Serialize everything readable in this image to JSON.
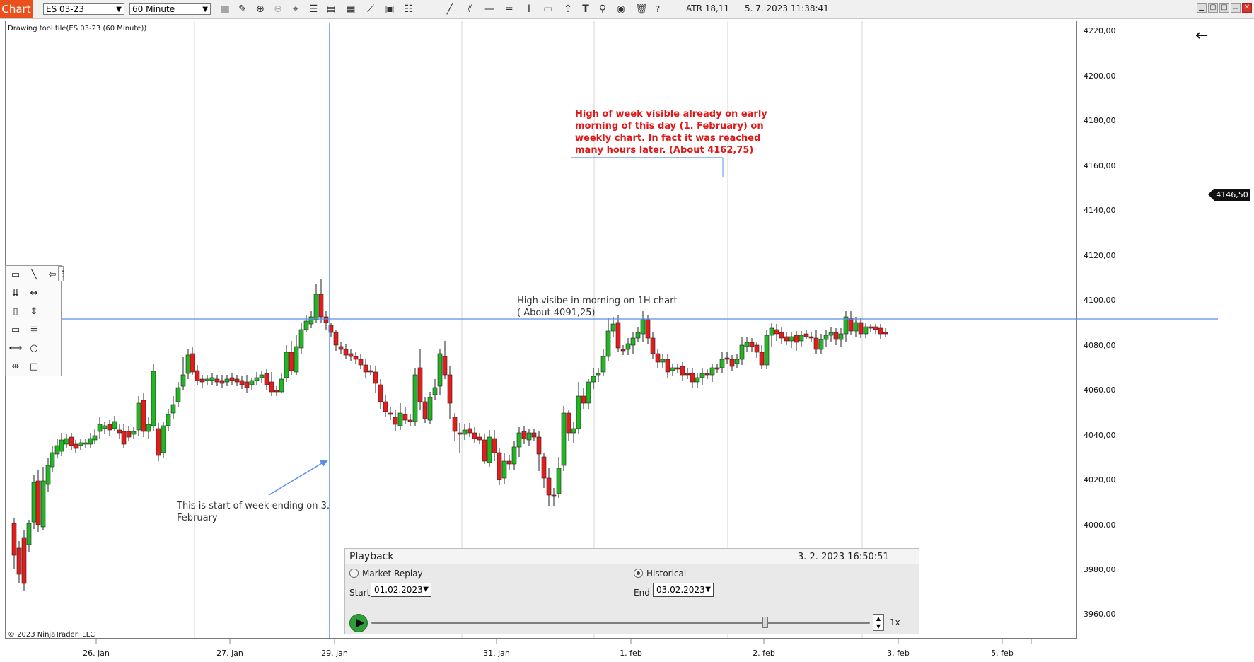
{
  "toolbar": {
    "chart_tab": "Chart",
    "instrument": "ES 03-23",
    "interval": "60 Minute",
    "atr": "ATR 18,11",
    "datetime": "5. 7. 2023 11:38:41",
    "icons": [
      "bar-type-icon",
      "pencil-icon",
      "zoom-in-icon",
      "zoom-out-icon",
      "crosshair-icon",
      "properties-icon",
      "templates-icon",
      "data-box-icon",
      "strategies-icon",
      "calculator-icon",
      "list-icon",
      "line-icon",
      "parallel-lines-icon",
      "horizontal-line-icon",
      "vertical-range-icon",
      "ruler-icon",
      "arrow-up-icon",
      "text-icon",
      "pin-icon",
      "eye-icon",
      "trash-icon",
      "help-icon"
    ]
  },
  "chart": {
    "label": "Drawing tool tile(ES 03-23 (60 Minute))",
    "copyright": "© 2023 NinjaTrader, LLC",
    "last_price": "4146,50",
    "y_ticks": [
      "4220,00",
      "4200,00",
      "4180,00",
      "4160,00",
      "4140,00",
      "4120,00",
      "4100,00",
      "4080,00",
      "4060,00",
      "4040,00",
      "4020,00",
      "4000,00",
      "3980,00",
      "3960,00"
    ],
    "x_ticks": [
      "26. jan",
      "27. jan",
      "29. jan",
      "31. jan",
      "1. feb",
      "2. feb",
      "3. feb",
      "5. feb"
    ],
    "annotations": {
      "high_1h_line1": "High visibe in morning on 1H chart",
      "high_1h_line2": "( About 4091,25)",
      "week_start_line1": "This is start of week ending on 3.",
      "week_start_line2": "February",
      "weekly_high_lines": [
        "High of week visible already on early",
        "morning of this day (1. February) on",
        "weekly chart. In fact it was reached",
        "many hours later. (About 4162,75)"
      ]
    },
    "colors": {
      "up": "#22b524",
      "down": "#e41c1c",
      "line": "#5b8fe6",
      "annotation_red": "#e01818"
    }
  },
  "drawing_tools": [
    "ruler-icon",
    "line-icon",
    "arrow-line-icon",
    "arrow-down-icon",
    "extended-line-icon",
    "range-icon",
    "vertical-line-icon",
    "rectangle-icon",
    "horizontal-lines-icon",
    "ray-icon",
    "circle-icon",
    "extended-ray-icon",
    "square-icon"
  ],
  "playback": {
    "title": "Playback",
    "time": "3. 2. 2023 16:50:51",
    "market_replay": "Market Replay",
    "historical": "Historical",
    "start_label": "Start",
    "start_date": "01.02.2023",
    "end_label": "End",
    "end_date": "03.02.2023",
    "speed": "1x",
    "progress": 0.79
  }
}
